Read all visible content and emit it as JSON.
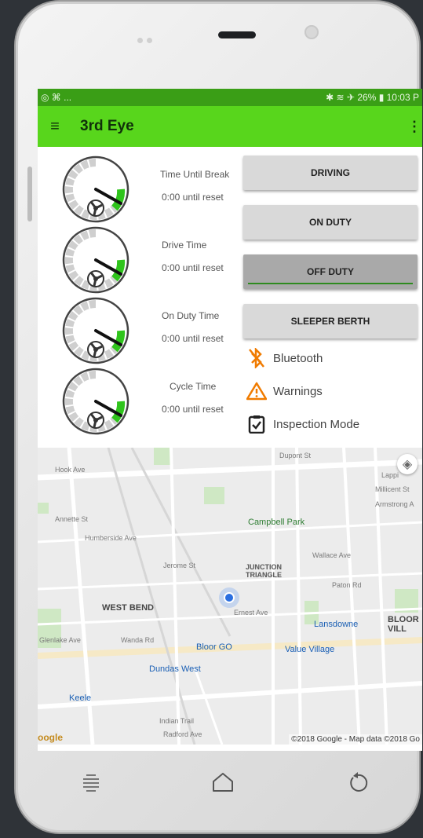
{
  "status_bar": {
    "left": "◎ ⌘ ...",
    "right": "✱ ≋ ✈ 26% ▮ 10:03 P"
  },
  "app_bar": {
    "title": "3rd Eye"
  },
  "gauges": [
    {
      "label": "Time Until Break",
      "value": "0:00 until reset"
    },
    {
      "label": "Drive Time",
      "value": "0:00 until reset"
    },
    {
      "label": "On Duty Time",
      "value": "0:00 until reset"
    },
    {
      "label": "Cycle Time",
      "value": "0:00 until reset"
    }
  ],
  "duty_buttons": [
    {
      "label": "DRIVING",
      "active": false
    },
    {
      "label": "ON DUTY",
      "active": false
    },
    {
      "label": "OFF DUTY",
      "active": true
    },
    {
      "label": "SLEEPER BERTH",
      "active": false
    }
  ],
  "status_items": {
    "bluetooth": "Bluetooth",
    "warnings": "Warnings",
    "inspection": "Inspection Mode"
  },
  "map": {
    "labels": {
      "hook_ave": "Hook Ave",
      "dupont": "Dupont St",
      "lappin": "Lappi",
      "millicent": "Millicent St",
      "armstrong": "Armstrong A",
      "annette": "Annette St",
      "humberside": "Humberside Ave",
      "campbell_park": "Campbell Park",
      "jerome": "Jerome St",
      "junction_triangle": "JUNCTION TRIANGLE",
      "wallace": "Wallace Ave",
      "paton": "Paton Rd",
      "west_bend": "WEST BEND",
      "ernest": "Ernest Ave",
      "lansdowne": "Lansdowne",
      "bloor_vill": "BLOOR VILL",
      "glenlake": "Glenlake Ave",
      "wanda": "Wanda Rd",
      "bloor_go": "Bloor GO",
      "value_village": "Value Village",
      "dundas_west": "Dundas West",
      "keele": "Keele",
      "indian_trail": "Indian Trail",
      "radford": "Radford Ave"
    },
    "logo": "oogle",
    "copyright": "©2018 Google - Map data ©2018 Go"
  },
  "colors": {
    "accent": "#58d61c",
    "status_bar": "#3a9e16",
    "bluetooth_icon": "#f07b00",
    "warning_icon": "#f07b00"
  }
}
